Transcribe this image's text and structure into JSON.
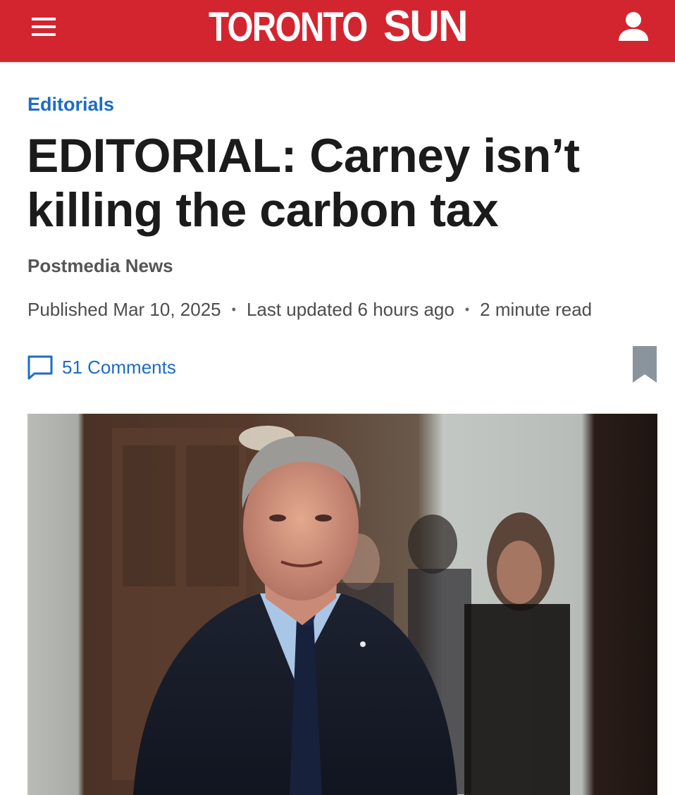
{
  "header": {
    "logo_part1": "TORONTO",
    "logo_part2": "SUN",
    "brand_color": "#d32530",
    "menu_icon": "hamburger-menu-icon",
    "account_icon": "user-icon"
  },
  "article": {
    "section": "Editorials",
    "headline": "EDITORIAL: Carney isn’t killing the carbon tax",
    "author": "Postmedia News",
    "published": "Published Mar 10, 2025",
    "updated": "Last updated 6 hours ago",
    "read_time": "2 minute read",
    "separator": "•",
    "comments_label": "51 Comments",
    "comment_icon": "comment-bubble-icon",
    "bookmark_icon": "bookmark-icon",
    "link_color": "#1c6cc7"
  }
}
